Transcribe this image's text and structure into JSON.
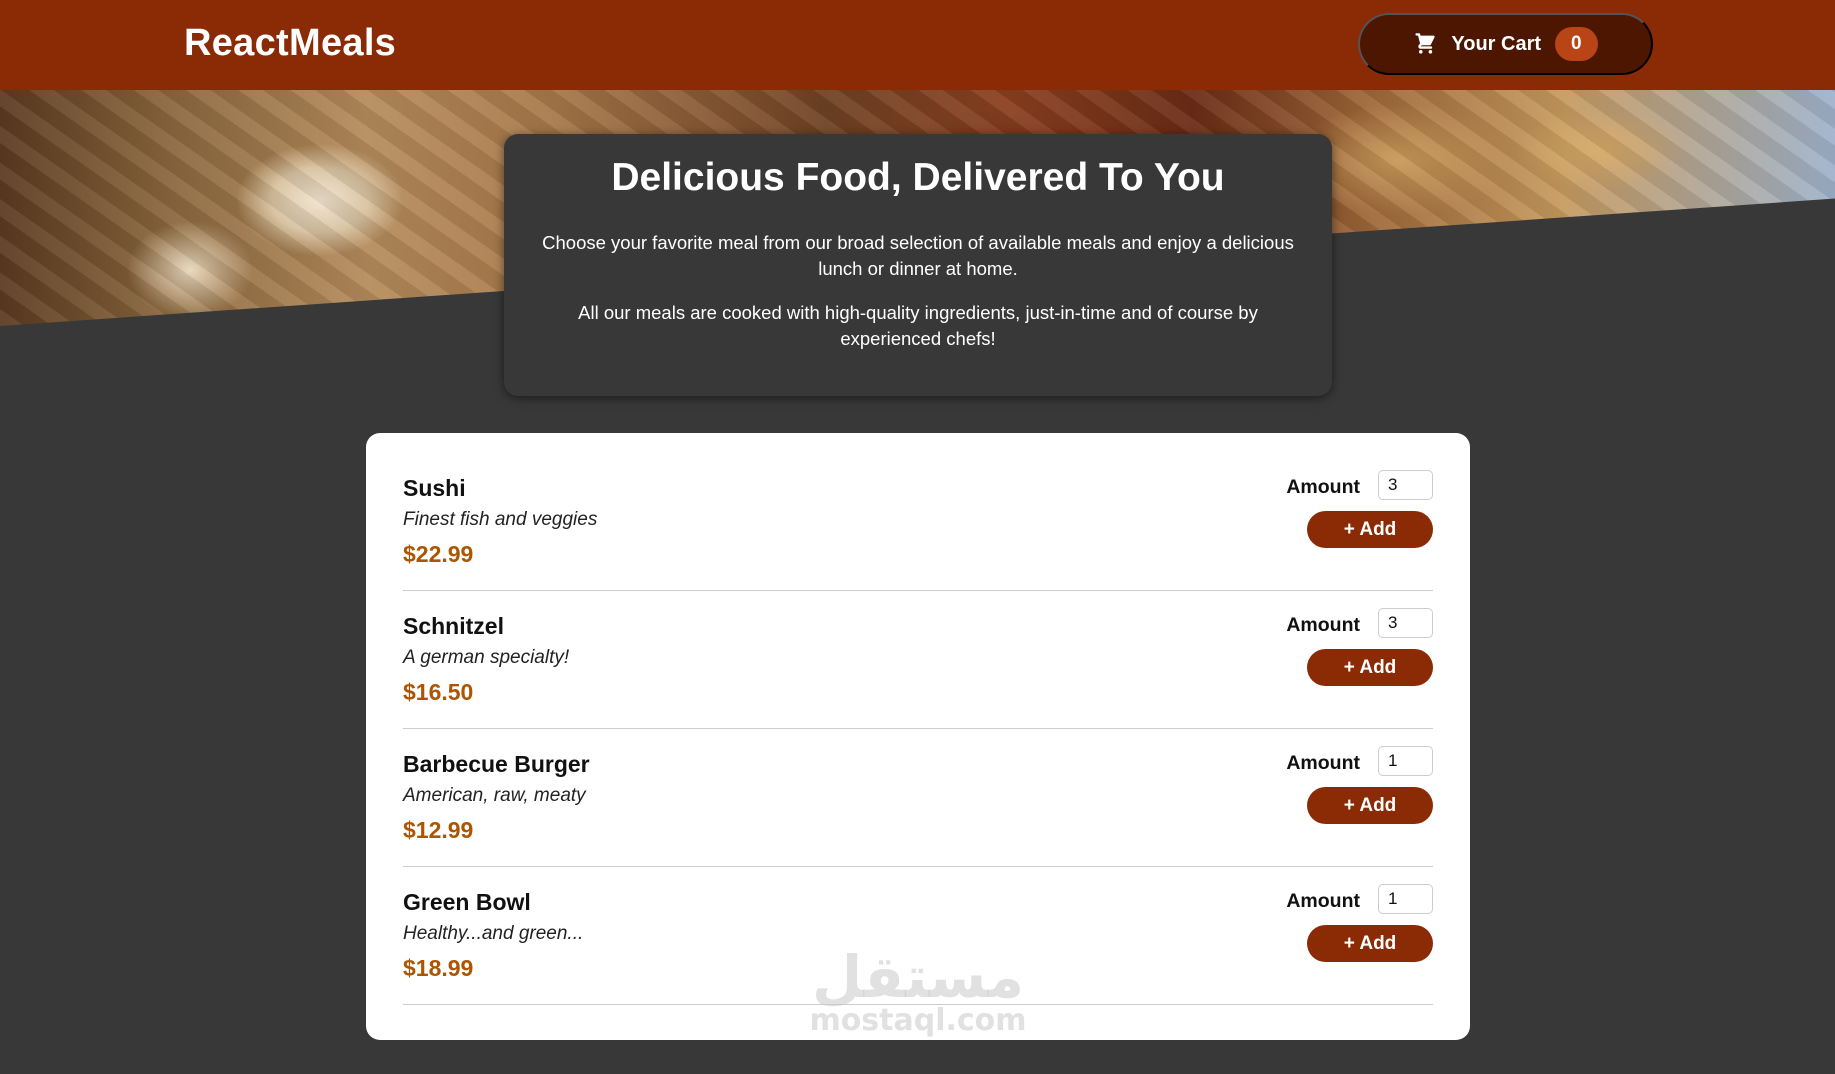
{
  "header": {
    "brand": "ReactMeals",
    "cart": {
      "label": "Your Cart",
      "count": "0",
      "icon": "cart-icon"
    }
  },
  "colors": {
    "header_bg": "#8a2b06",
    "cart_bg": "#4d1601",
    "badge_bg": "#b94517",
    "page_bg": "#383838",
    "price": "#ad5502"
  },
  "summary": {
    "title": "Delicious Food, Delivered To You",
    "paragraph1": "Choose your favorite meal from our broad selection of available meals and enjoy a delicious lunch or dinner at home.",
    "paragraph2": "All our meals are cooked with high-quality ingredients, just-in-time and of course by experienced chefs!"
  },
  "meals": [
    {
      "name": "Sushi",
      "description": "Finest fish and veggies",
      "price": "$22.99",
      "amount_label": "Amount",
      "amount": "3",
      "add_label": "+ Add"
    },
    {
      "name": "Schnitzel",
      "description": "A german specialty!",
      "price": "$16.50",
      "amount_label": "Amount",
      "amount": "3",
      "add_label": "+ Add"
    },
    {
      "name": "Barbecue Burger",
      "description": "American, raw, meaty",
      "price": "$12.99",
      "amount_label": "Amount",
      "amount": "1",
      "add_label": "+ Add"
    },
    {
      "name": "Green Bowl",
      "description": "Healthy...and green...",
      "price": "$18.99",
      "amount_label": "Amount",
      "amount": "1",
      "add_label": "+ Add"
    }
  ],
  "watermark": {
    "arabic": "مستقل",
    "latin": "mostaql.com"
  }
}
